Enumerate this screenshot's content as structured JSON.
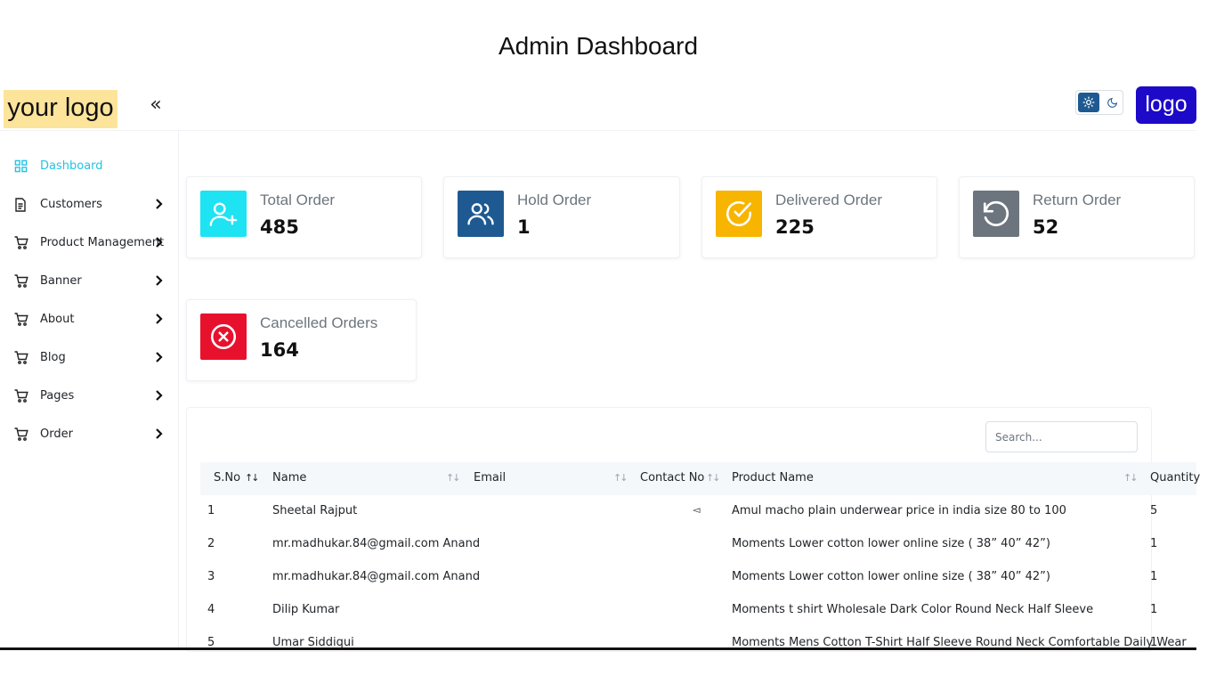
{
  "page_title": "Admin Dashboard",
  "header": {
    "logo_left_text": "your logo",
    "collapse_symbol": "«",
    "logo_right_text": "logo",
    "theme_icons": [
      "sun-icon",
      "moon-icon"
    ]
  },
  "sidebar": {
    "items": [
      {
        "label": "Dashboard",
        "icon": "grid-icon",
        "active": true
      },
      {
        "label": "Customers",
        "icon": "document-icon"
      },
      {
        "label": "Product Management",
        "icon": "cart-icon"
      },
      {
        "label": "Banner",
        "icon": "cart-icon"
      },
      {
        "label": "About",
        "icon": "cart-icon"
      },
      {
        "label": "Blog",
        "icon": "cart-icon"
      },
      {
        "label": "Pages",
        "icon": "cart-icon"
      },
      {
        "label": "Order",
        "icon": "cart-icon"
      }
    ]
  },
  "stats": [
    {
      "label": "Total Order",
      "value": "485",
      "color": "#1de3f2",
      "icon": "user-plus-icon"
    },
    {
      "label": "Hold Order",
      "value": "1",
      "color": "#1e5a91",
      "icon": "users-icon"
    },
    {
      "label": "Delivered Order",
      "value": "225",
      "color": "#f7b500",
      "icon": "check-circle-icon"
    },
    {
      "label": "Return Order",
      "value": "52",
      "color": "#6c757d",
      "icon": "undo-icon"
    },
    {
      "label": "Cancelled Orders",
      "value": "164",
      "color": "#e8112d",
      "icon": "x-circle-icon"
    }
  ],
  "table": {
    "search_placeholder": "Search...",
    "columns": [
      "S.No",
      "Name",
      "Email",
      "Contact No",
      "Product Name",
      "Quantity"
    ],
    "rows": [
      {
        "sno": "1",
        "name": "Sheetal Rajput",
        "email": "",
        "contact": "",
        "product": "Amul macho plain underwear price in india size 80 to 100",
        "qty": "5"
      },
      {
        "sno": "2",
        "name": "mr.madhukar.84@gmail.com Anand",
        "email": "",
        "contact": "",
        "product": "Moments Lower cotton lower online size ( 38” 40” 42”)",
        "qty": "1"
      },
      {
        "sno": "3",
        "name": "mr.madhukar.84@gmail.com Anand",
        "email": "",
        "contact": "",
        "product": "Moments Lower cotton lower online size ( 38” 40” 42”)",
        "qty": "1"
      },
      {
        "sno": "4",
        "name": "Dilip Kumar",
        "email": "",
        "contact": "",
        "product": "Moments t shirt Wholesale Dark Color Round Neck Half Sleeve",
        "qty": "1"
      },
      {
        "sno": "5",
        "name": "Umar Siddiqui",
        "email": "",
        "contact": "",
        "product": "Moments Mens Cotton T-Shirt Half Sleeve Round Neck Comfortable Daily Wear",
        "qty": "1"
      }
    ]
  },
  "colors": {
    "accent": "#22c3e6",
    "logo_left_bg": "#fde49b",
    "logo_right_bg": "#1d09c8",
    "theme_active": "#1e5a91"
  }
}
